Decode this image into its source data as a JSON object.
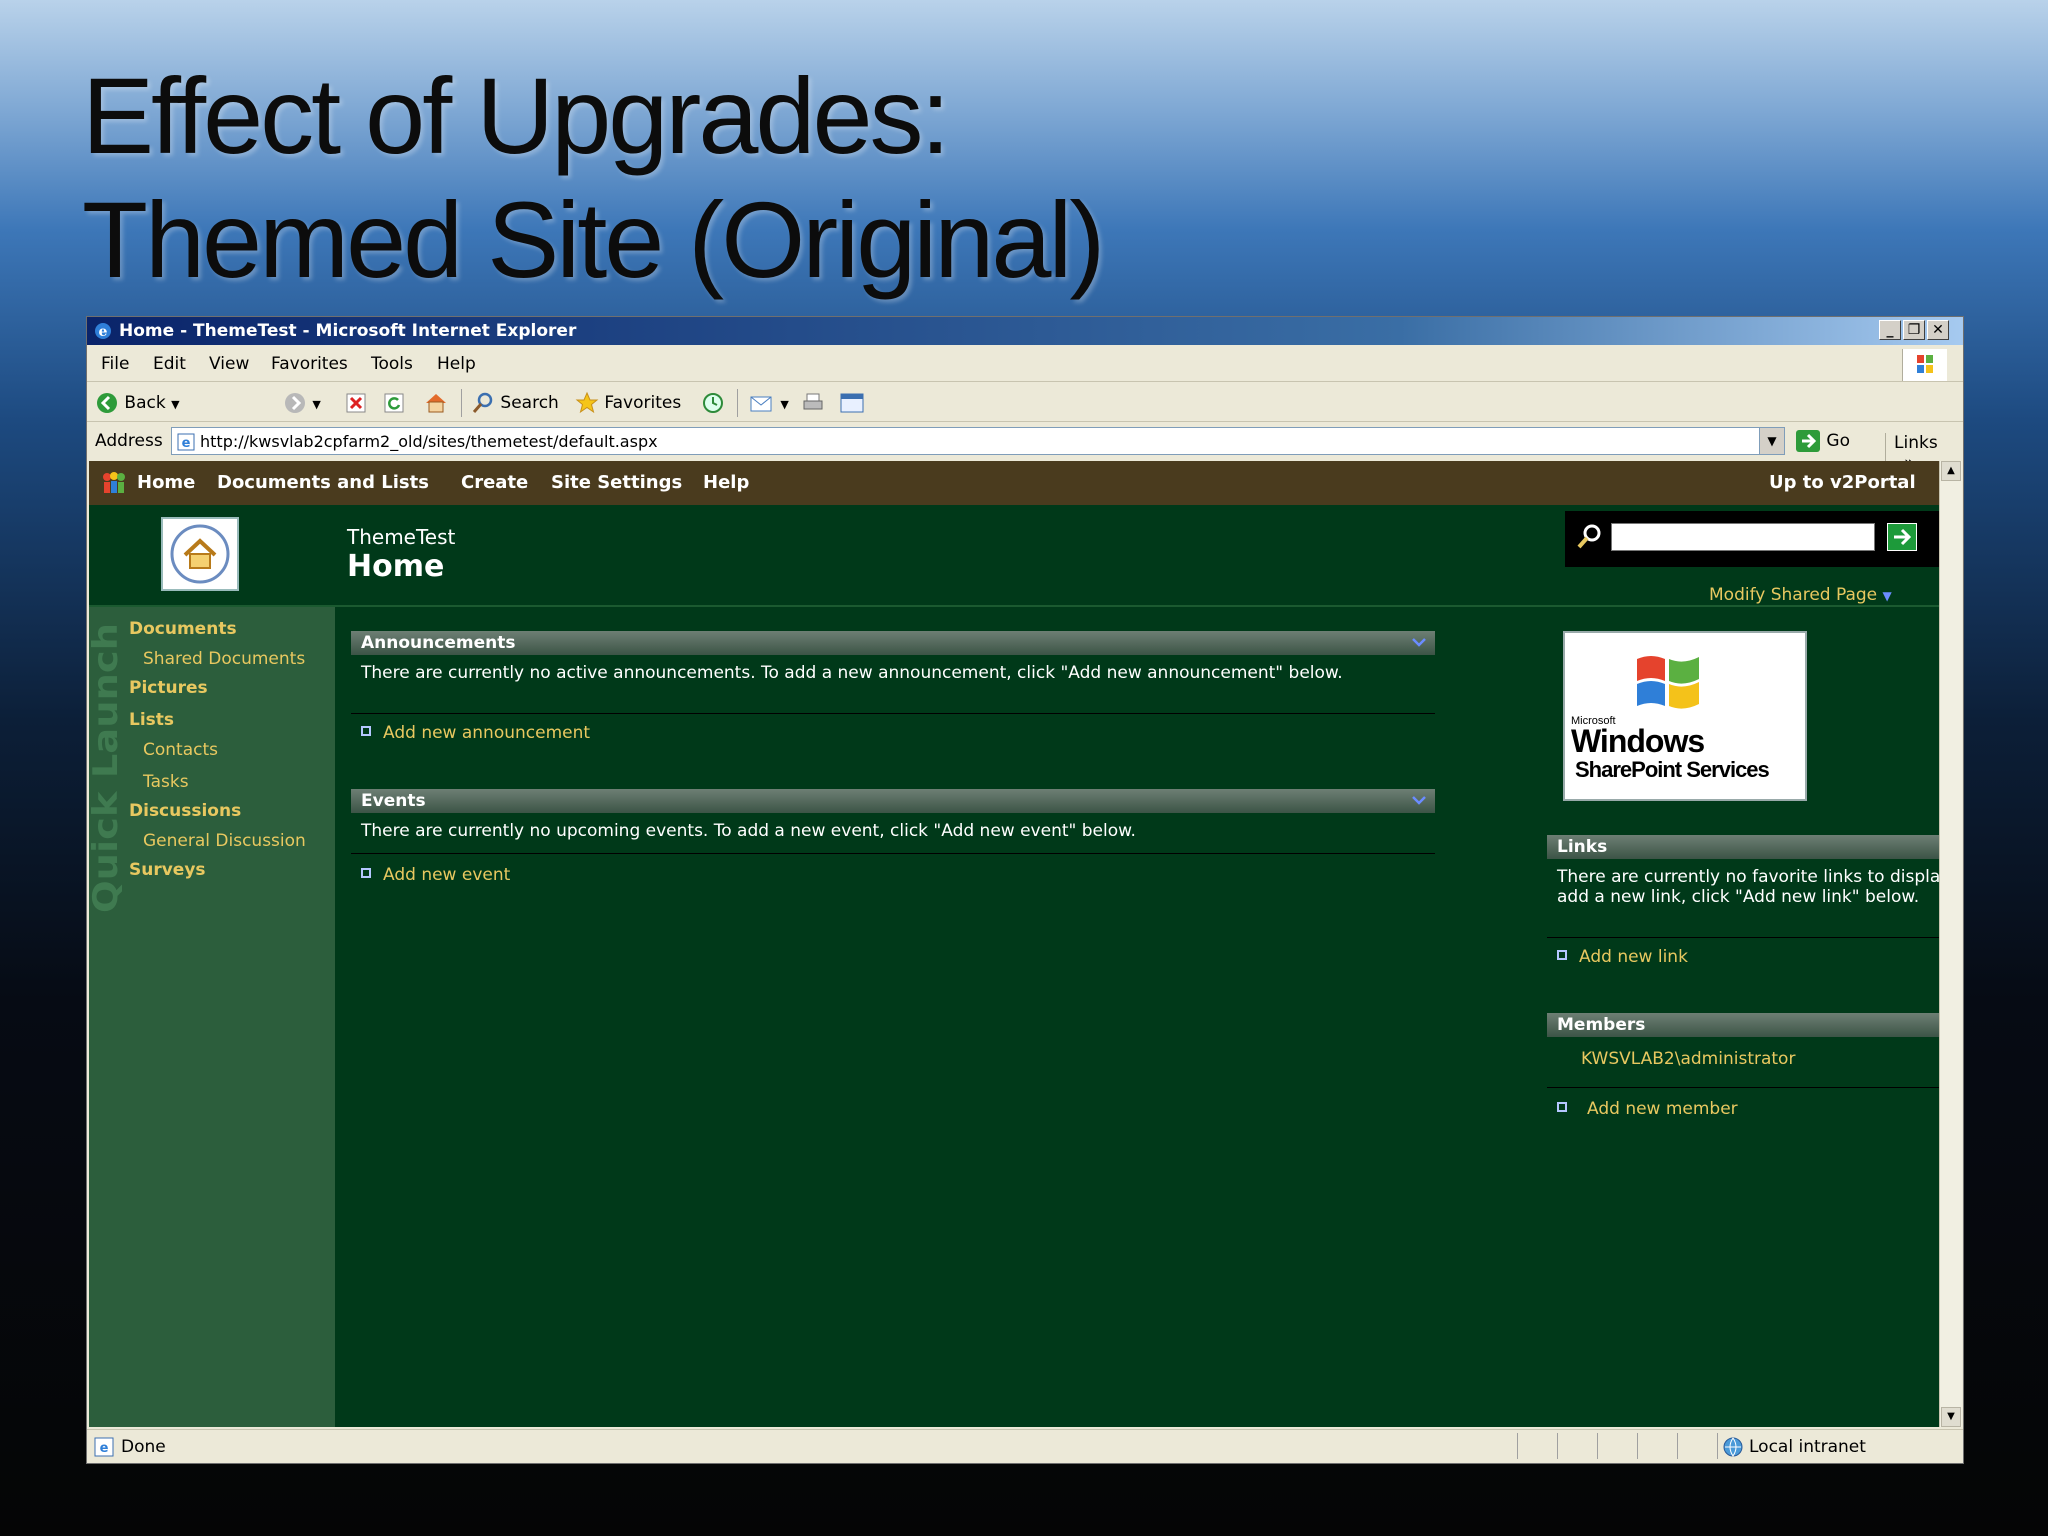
{
  "slide": {
    "title_line1": "Effect of Upgrades:",
    "title_line2": "Themed Site (Original)"
  },
  "window": {
    "title": "Home - ThemeTest - Microsoft Internet Explorer"
  },
  "menu": {
    "items": [
      "File",
      "Edit",
      "View",
      "Favorites",
      "Tools",
      "Help"
    ]
  },
  "toolbar": {
    "back": "Back",
    "search": "Search",
    "favorites": "Favorites"
  },
  "address": {
    "label": "Address",
    "url": "http://kwsvlab2cpfarm2_old/sites/themetest/default.aspx",
    "go": "Go",
    "links": "Links"
  },
  "sharepoint": {
    "topnav": [
      "Home",
      "Documents and Lists",
      "Create",
      "Site Settings",
      "Help"
    ],
    "up_link": "Up to v2Portal",
    "site_name": "ThemeTest",
    "page_name": "Home",
    "modify_shared_page": "Modify Shared Page",
    "quick_launch_label": "Quick Launch",
    "quick_launch": {
      "documents": "Documents",
      "shared_documents": "Shared Documents",
      "pictures": "Pictures",
      "lists": "Lists",
      "contacts": "Contacts",
      "tasks": "Tasks",
      "discussions": "Discussions",
      "general_discussion": "General Discussion",
      "surveys": "Surveys"
    },
    "announcements": {
      "title": "Announcements",
      "body": "There are currently no active announcements. To add a new announcement, click \"Add new announcement\" below.",
      "add": "Add new announcement"
    },
    "events": {
      "title": "Events",
      "body": "There are currently no upcoming events. To add a new event, click \"Add new event\" below.",
      "add": "Add new event"
    },
    "logo": {
      "microsoft": "Microsoft",
      "windows": "Windows",
      "product": "SharePoint Services"
    },
    "links": {
      "title": "Links",
      "body": "There are currently no favorite links to display. To add a new link, click \"Add new link\" below.",
      "add": "Add new link"
    },
    "members": {
      "title": "Members",
      "member": "KWSVLAB2\\administrator",
      "add": "Add new member"
    }
  },
  "status": {
    "text": "Done",
    "zone": "Local intranet"
  },
  "colors": {
    "page_bg": "#003919",
    "topnav_bg": "#4a3b1e",
    "quicklaunch_bg": "#2c5e3c",
    "link": "#e8c860"
  }
}
